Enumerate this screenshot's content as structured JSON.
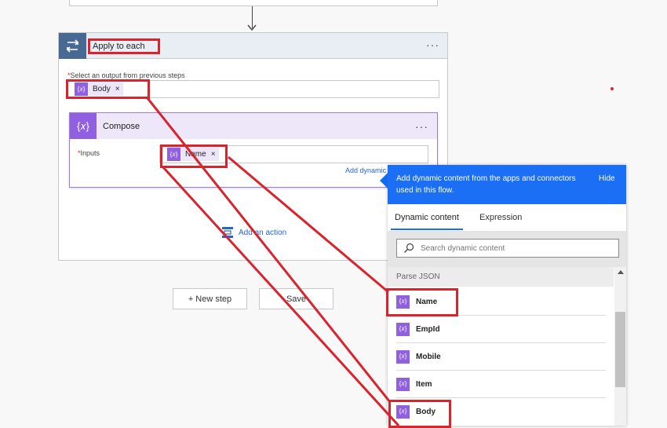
{
  "apply_to_each": {
    "title": "Apply to each",
    "output_label": "Select an output from previous steps",
    "required_mark": "*",
    "token": {
      "label": "Body",
      "remove": "×"
    }
  },
  "compose": {
    "title": "Compose",
    "inputs_label": "Inputs",
    "required_mark": "*",
    "token": {
      "label": "Name",
      "remove": "×"
    },
    "add_dynamic": "Add dynamic content"
  },
  "add_action": "Add an action",
  "buttons": {
    "new_step": "+ New step",
    "save": "Save"
  },
  "more_menu": "···",
  "dynamic_panel": {
    "header_text": "Add dynamic content from the apps and connectors used in this flow.",
    "hide": "Hide",
    "tabs": [
      "Dynamic content",
      "Expression"
    ],
    "search_placeholder": "Search dynamic content",
    "section": "Parse JSON",
    "items": [
      "Name",
      "EmpId",
      "Mobile",
      "Item",
      "Body"
    ]
  },
  "icons": {
    "loop": "loop-icon",
    "compose": "compose-icon",
    "token": "expression-icon",
    "search": "search-icon",
    "add_action": "add-action-icon"
  },
  "colors": {
    "accent_blue": "#1a6ff5",
    "compose_purple": "#9160e0",
    "loop_navy": "#486991",
    "highlight_red": "#d9232d"
  }
}
